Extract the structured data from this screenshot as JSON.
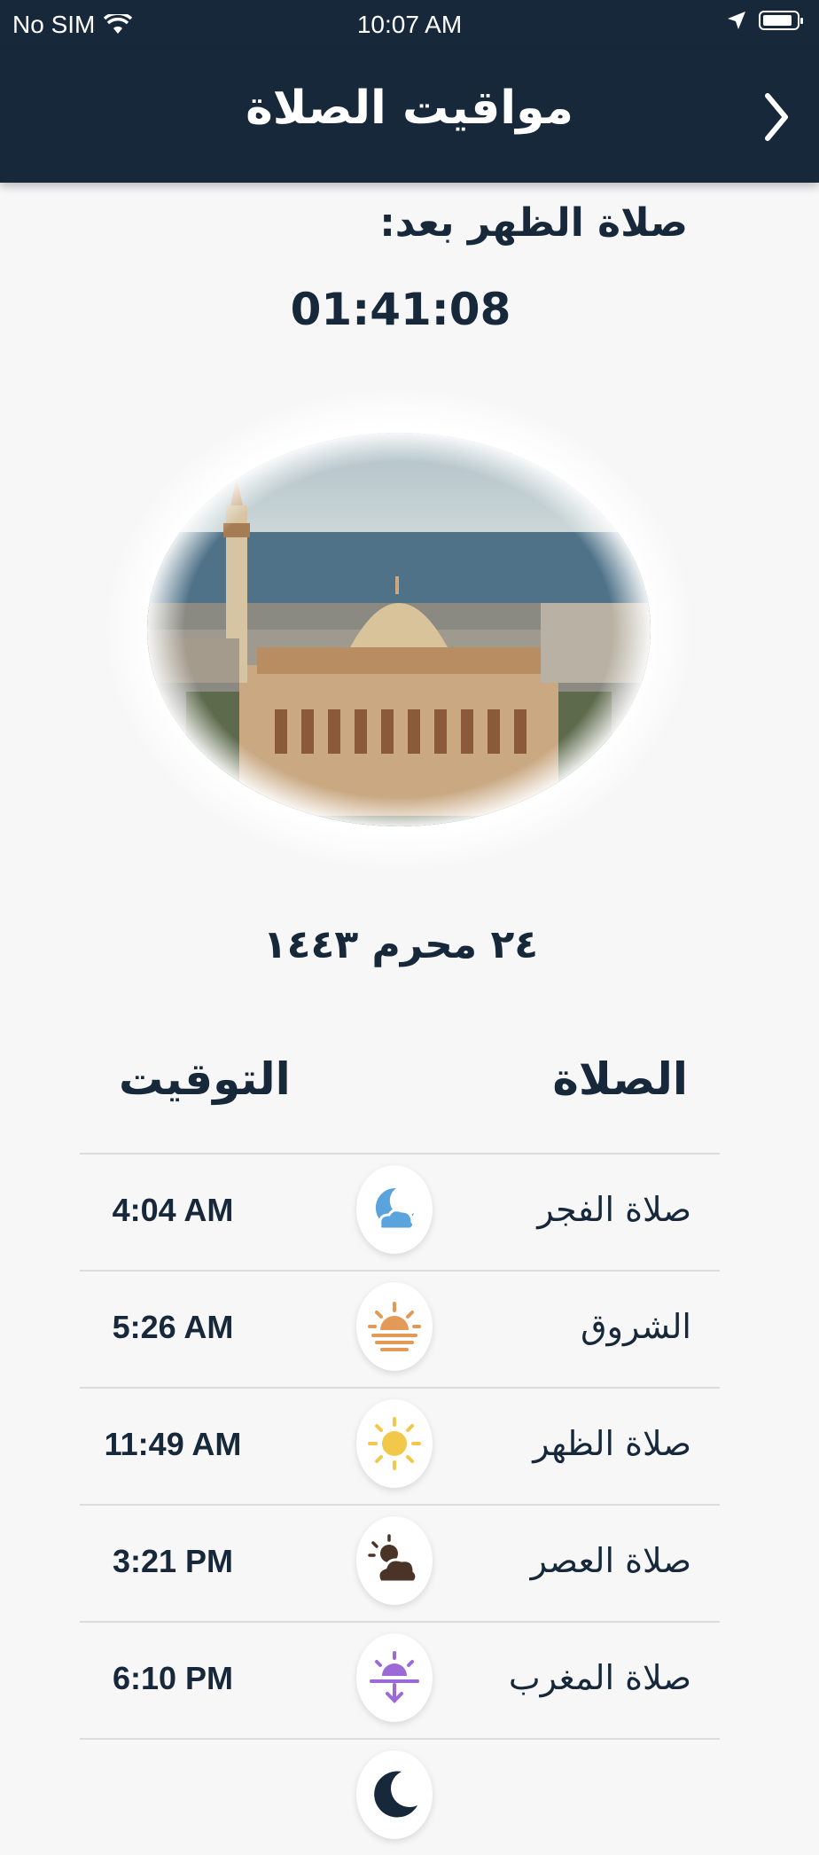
{
  "status_bar": {
    "carrier": "No SIM",
    "time": "10:07 AM"
  },
  "header": {
    "title": "مواقيت الصلاة"
  },
  "countdown": {
    "label": "صلاة الظهر بعد:",
    "time": "01:41:08"
  },
  "hijri_date": "٢٤ محرم ١٤٤٣",
  "table": {
    "col_prayer": "الصلاة",
    "col_time": "التوقيت",
    "rows": [
      {
        "name": "صلاة الفجر",
        "time": "4:04 AM",
        "icon": "moon-cloud-icon",
        "color": "#5aa3dd"
      },
      {
        "name": "الشروق",
        "time": "5:26 AM",
        "icon": "sunrise-icon",
        "color": "#e29a56"
      },
      {
        "name": "صلاة الظهر",
        "time": "11:49 AM",
        "icon": "sun-icon",
        "color": "#f1c84a"
      },
      {
        "name": "صلاة العصر",
        "time": "3:21 PM",
        "icon": "sun-cloud-icon",
        "color": "#4a3428"
      },
      {
        "name": "صلاة المغرب",
        "time": "6:10 PM",
        "icon": "sunset-icon",
        "color": "#9b6ad6"
      }
    ]
  },
  "colors": {
    "header_bg": "#16283a",
    "page_bg": "#f7f7f8"
  }
}
